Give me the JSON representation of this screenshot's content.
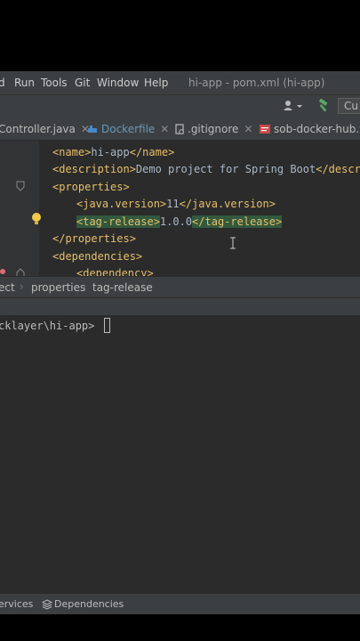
{
  "menu": {
    "items": [
      "d",
      "Run",
      "Tools",
      "Git",
      "Window",
      "Help"
    ],
    "window_title": "hi-app - pom.xml (hi-app)"
  },
  "toolbar": {
    "user_icon": "user-icon",
    "hammer_icon": "hammer-icon",
    "run_config_label": "Cu"
  },
  "tabs": [
    {
      "label": "Controller.java",
      "closable": true,
      "color": "#bbbbbb"
    },
    {
      "label": "Dockerfile",
      "closable": true,
      "color": "#6897bb"
    },
    {
      "label": ".gitignore",
      "closable": true,
      "color": "#bbbbbb"
    },
    {
      "label": "sob-docker-hub.ya",
      "closable": false,
      "color": "#bbbbbb"
    }
  ],
  "editor": {
    "lines": [
      {
        "open": "<name>",
        "text": "hi-app",
        "close": "</name>"
      },
      {
        "open": "<description>",
        "text": "Demo project for Spring Boot",
        "close": "</descrip"
      },
      {
        "open": "<properties>",
        "text": "",
        "close": ""
      },
      {
        "open": "<java.version>",
        "text": "11",
        "close": "</java.version>"
      },
      {
        "open": "<tag-release>",
        "text": "1.0.0",
        "close": "</tag-release>"
      },
      {
        "open": "</properties>",
        "text": "",
        "close": ""
      },
      {
        "open": "<dependencies>",
        "text": "",
        "close": ""
      },
      {
        "open": "<dependency>",
        "text": "",
        "close": ""
      }
    ]
  },
  "breadcrumb": [
    "ect",
    "properties",
    "tag-release"
  ],
  "terminal": {
    "prompt": "cklayer\\hi-app> "
  },
  "bottom_tools": [
    "ervices",
    "Dependencies"
  ],
  "colors": {
    "xml_tag": "#e8bf6a",
    "text": "#a9b7c6",
    "match_highlight": "#32593d",
    "editor_bg": "#2b2b2b",
    "panel_bg": "#3c3f41"
  }
}
